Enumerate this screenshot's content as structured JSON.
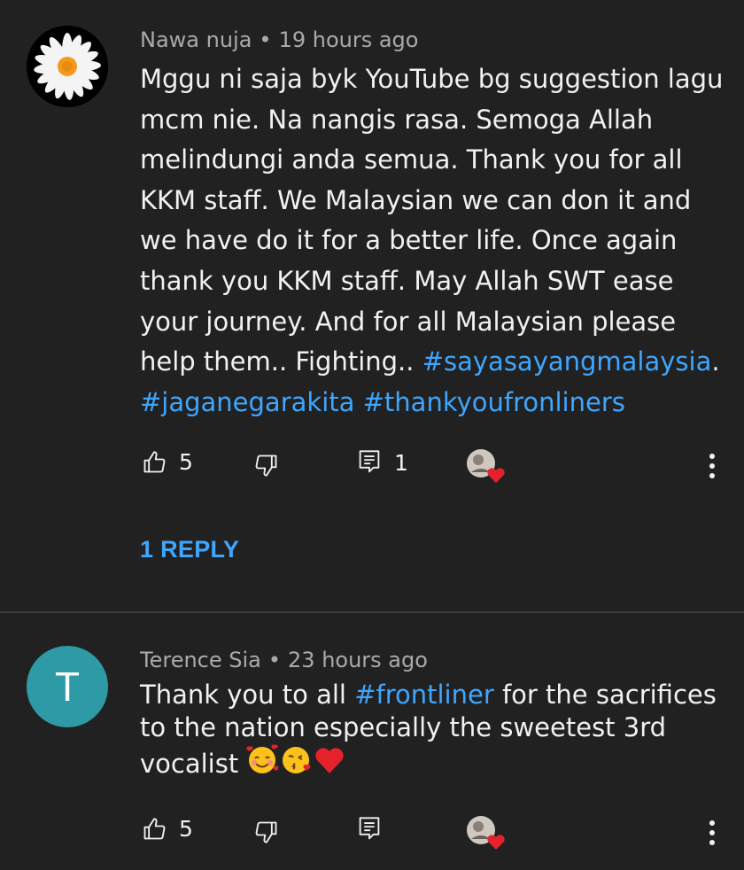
{
  "comments": [
    {
      "author": "Nawa nuja",
      "separator": "•",
      "time": "19 hours ago",
      "lines": [
        [
          {
            "t": "Mggu ni saja byk YouTube bg suggestion lagu"
          }
        ],
        [
          {
            "t": "mcm nie. Na nangis rasa. Semoga Allah"
          }
        ],
        [
          {
            "t": "melindungi anda semua. Thank you for all"
          }
        ],
        [
          {
            "t": "KKM staff. We Malaysian we can don it and"
          }
        ],
        [
          {
            "t": "we have do it for a better life. Once again"
          }
        ],
        [
          {
            "t": "thank you KKM staff. May Allah SWT ease"
          }
        ],
        [
          {
            "t": "your journey. And for all Malaysian please"
          }
        ],
        [
          {
            "t": "help them.. Fighting.. "
          },
          {
            "t": "#sayasayangmalaysia",
            "tag": true
          },
          {
            "t": "."
          }
        ],
        [
          {
            "t": "#jaganegarakita",
            "tag": true
          },
          {
            "t": " "
          },
          {
            "t": "#thankyoufronliners",
            "tag": true
          }
        ]
      ],
      "likes": "5",
      "replies_count": "1",
      "view_replies_label": "1 REPLY"
    },
    {
      "author": "Terence Sia",
      "separator": "•",
      "time": "23 hours ago",
      "avatar_letter": "T",
      "avatar_color": "#2e9aa6",
      "lines": [
        [
          {
            "t": "Thank you to all "
          },
          {
            "t": "#frontliner",
            "tag": true
          },
          {
            "t": " for the sacrifices"
          }
        ],
        [
          {
            "t": "to the nation especially the sweetest 3rd"
          }
        ],
        [
          {
            "t": "vocalist "
          }
        ]
      ],
      "emojis": [
        "smiling-face-with-hearts",
        "face-blowing-kiss",
        "red-heart"
      ],
      "likes": "5"
    }
  ],
  "colors": {
    "background": "#212121",
    "link": "#3ea6ff",
    "meta": "#aaaaaa",
    "text": "#f1f1f1"
  }
}
